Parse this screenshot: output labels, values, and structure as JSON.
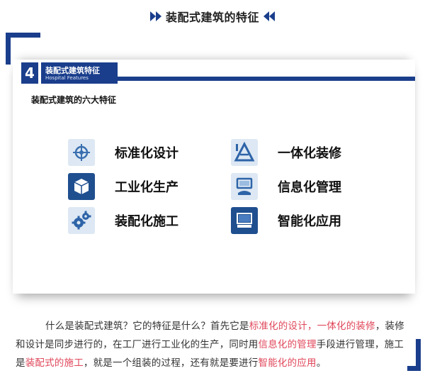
{
  "header": {
    "title": "装配式建筑的特征"
  },
  "slide": {
    "number": "4",
    "title": "装配式建筑特征",
    "subtitle": "Hospital Features",
    "heading": "装配式建筑的六大特征",
    "features": [
      {
        "label": "标准化设计",
        "icon": "crosshair-magnifier-icon"
      },
      {
        "label": "一体化装修",
        "icon": "triangle-ruler-icon"
      },
      {
        "label": "工业化生产",
        "icon": "cube-icon"
      },
      {
        "label": "信息化管理",
        "icon": "computer-hand-icon"
      },
      {
        "label": "装配化施工",
        "icon": "gears-icon"
      },
      {
        "label": "智能化应用",
        "icon": "monitor-icon"
      }
    ]
  },
  "paragraph": {
    "parts": [
      "什么是装配式建筑？它的特征是什么？首先它是",
      "标准化的设计，一体化的装修",
      "，装修和设计是同步进行的，在工厂进行工业化的生产，同时用",
      "信息化的管理",
      "手段进行管理，施工是",
      "装配式的施工",
      "，就是一个组装的过程，还有就是要进行",
      "智能化的应用",
      "。"
    ]
  },
  "colors": {
    "brand": "#1a3e8c",
    "highlight": "#e0475a"
  }
}
